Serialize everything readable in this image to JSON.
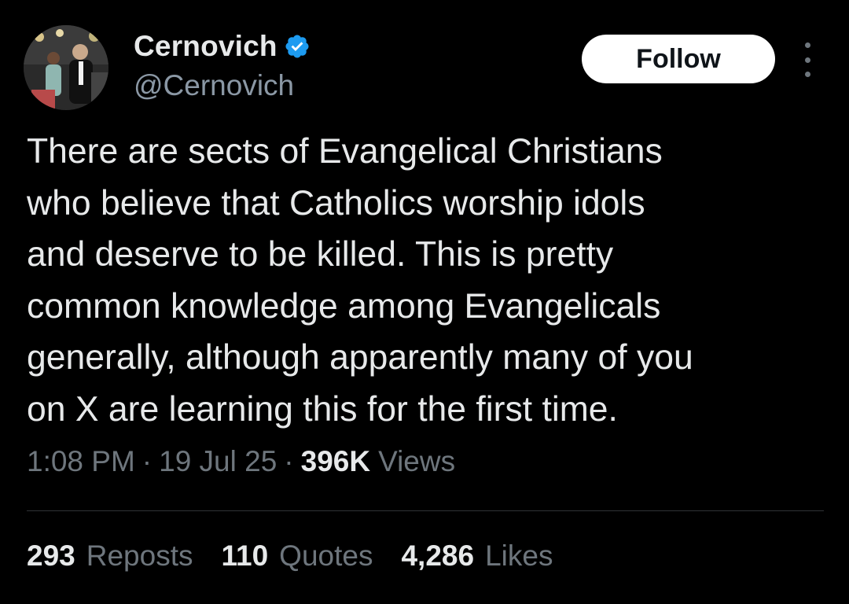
{
  "user": {
    "display_name": "Cernovich",
    "handle": "@Cernovich",
    "verified_icon": "verified-badge-icon",
    "verified_color": "#1d9bf0"
  },
  "header": {
    "follow_label": "Follow",
    "more_icon": "more-vertical-icon"
  },
  "tweet": {
    "text": "There are sects of Evangelical Christians\nwho believe that Catholics worship idols\nand deserve to be killed. This is pretty\ncommon knowledge among Evangelicals\ngenerally, although apparently many of you\non X are learning this for the first time.",
    "time": "1:08 PM",
    "date": "19 Jul 25",
    "separator": "·",
    "views_count": "396K",
    "views_label": "Views"
  },
  "stats": {
    "reposts_count": "293",
    "reposts_label": "Reposts",
    "quotes_count": "110",
    "quotes_label": "Quotes",
    "likes_count": "4,286",
    "likes_label": "Likes"
  },
  "colors": {
    "background": "#000000",
    "primary_text": "#e7e9ea",
    "secondary_text": "#6e767d",
    "divider": "#2f3336",
    "follow_bg": "#ffffff"
  }
}
